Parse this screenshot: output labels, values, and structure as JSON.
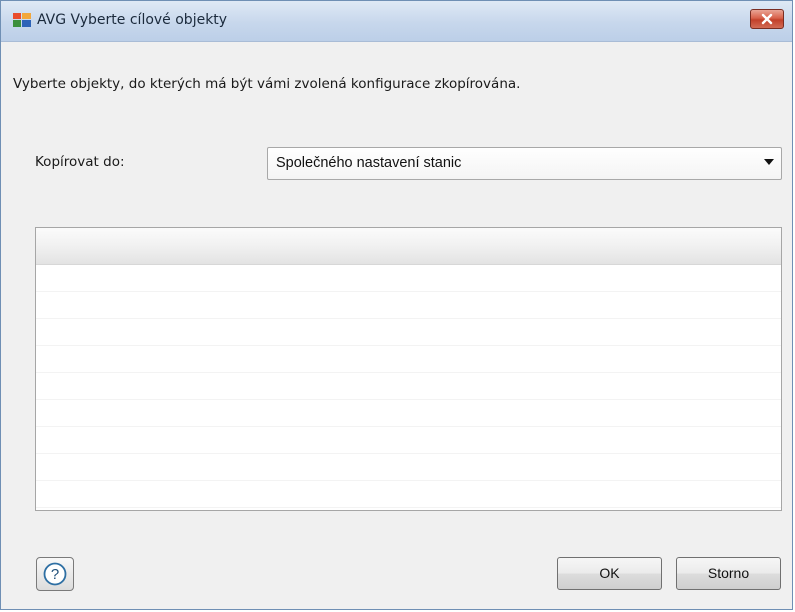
{
  "window": {
    "title": "AVG Vyberte cílové objekty",
    "app_icon": "avg-logo-icon",
    "close_icon": "close-icon"
  },
  "dialog": {
    "instruction": "Vyberte objekty, do kterých má být vámi zvolená konfigurace zkopírována.",
    "copy_to_label": "Kopírovat do:",
    "copy_to_value": "Společného nastavení stanic"
  },
  "list": {
    "rows": [
      "",
      "",
      "",
      "",
      "",
      "",
      "",
      "",
      ""
    ]
  },
  "buttons": {
    "help_icon": "question-mark-icon",
    "ok": "OK",
    "cancel": "Storno"
  },
  "colors": {
    "titlebar": "#c7d7ec",
    "close_button": "#c2402a",
    "window_background": "#f0f0f0"
  }
}
